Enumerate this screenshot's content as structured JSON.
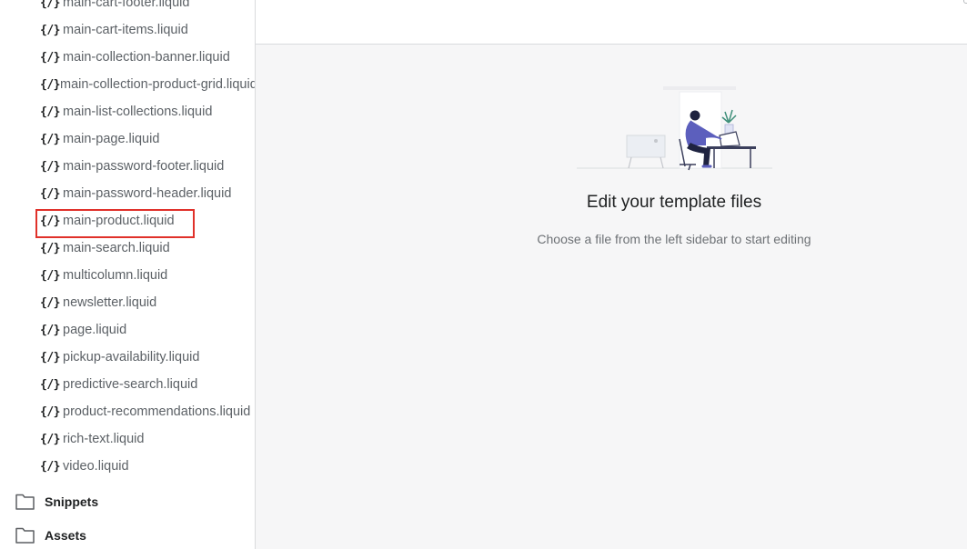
{
  "sidebar": {
    "files": [
      {
        "icon": "{/}",
        "label": "main-cart-footer.liquid"
      },
      {
        "icon": "{/}",
        "label": "main-cart-items.liquid"
      },
      {
        "icon": "{/}",
        "label": "main-collection-banner.liquid"
      },
      {
        "icon": "{/}",
        "label": "main-collection-product-grid.liquid"
      },
      {
        "icon": "{/}",
        "label": "main-list-collections.liquid"
      },
      {
        "icon": "{/}",
        "label": "main-page.liquid"
      },
      {
        "icon": "{/}",
        "label": "main-password-footer.liquid"
      },
      {
        "icon": "{/}",
        "label": "main-password-header.liquid"
      },
      {
        "icon": "{/}",
        "label": "main-product.liquid"
      },
      {
        "icon": "{/}",
        "label": "main-search.liquid"
      },
      {
        "icon": "{/}",
        "label": "multicolumn.liquid"
      },
      {
        "icon": "{/}",
        "label": "newsletter.liquid"
      },
      {
        "icon": "{/}",
        "label": "page.liquid"
      },
      {
        "icon": "{/}",
        "label": "pickup-availability.liquid"
      },
      {
        "icon": "{/}",
        "label": "predictive-search.liquid"
      },
      {
        "icon": "{/}",
        "label": "product-recommendations.liquid"
      },
      {
        "icon": "{/}",
        "label": "rich-text.liquid"
      },
      {
        "icon": "{/}",
        "label": "video.liquid"
      }
    ],
    "folders": [
      {
        "label": "Snippets",
        "icon": "folder-icon"
      },
      {
        "label": "Assets",
        "icon": "folder-icon"
      }
    ]
  },
  "main": {
    "empty_state": {
      "title": "Edit your template files",
      "subtitle": "Choose a file from the left sidebar to start editing",
      "illustration": "person-at-desk-illustration"
    }
  },
  "colors": {
    "highlight_border": "#e0312a",
    "illustration_accent": "#5c5fbd"
  }
}
